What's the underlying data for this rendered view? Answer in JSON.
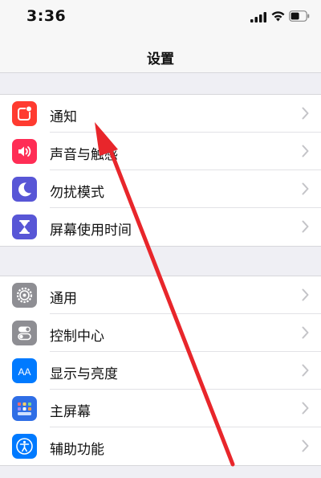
{
  "status": {
    "time": "3:36"
  },
  "nav": {
    "title": "设置"
  },
  "colors": {
    "notifications": "#ff3b30",
    "sounds": "#ff2d55",
    "dnd": "#5856d6",
    "screen_time": "#5856d6",
    "general": "#8e8e93",
    "control_center": "#8e8e93",
    "display": "#007aff",
    "home_screen": "#2f6ee6",
    "accessibility": "#007aff",
    "annotation_arrow": "#e8262b"
  },
  "group1": [
    {
      "label": "通知",
      "icon": "notifications-icon"
    },
    {
      "label": "声音与触感",
      "icon": "sounds-icon"
    },
    {
      "label": "勿扰模式",
      "icon": "moon-icon"
    },
    {
      "label": "屏幕使用时间",
      "icon": "hourglass-icon"
    }
  ],
  "group2": [
    {
      "label": "通用",
      "icon": "gear-icon"
    },
    {
      "label": "控制中心",
      "icon": "toggles-icon"
    },
    {
      "label": "显示与亮度",
      "icon": "text-size-icon",
      "icon_text": "AA"
    },
    {
      "label": "主屏幕",
      "icon": "app-grid-icon"
    },
    {
      "label": "辅助功能",
      "icon": "accessibility-icon"
    }
  ]
}
